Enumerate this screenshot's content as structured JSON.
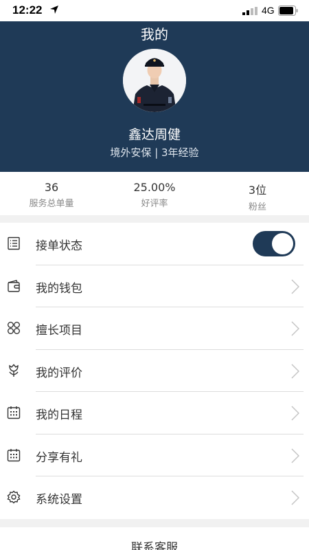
{
  "status_bar": {
    "time": "12:22",
    "network": "4G",
    "icons": [
      "location-arrow-icon",
      "signal-icon",
      "battery-icon"
    ]
  },
  "header": {
    "title": "我的",
    "name": "鑫达周健",
    "description": "境外安保 | 3年经验"
  },
  "stats": [
    {
      "value": "36",
      "label": "服务总单量"
    },
    {
      "value": "25.00%",
      "label": "好评率"
    },
    {
      "value": "3位",
      "label": "粉丝"
    }
  ],
  "menu": [
    {
      "label": "接单状态",
      "icon": "list-icon",
      "control": "toggle",
      "toggle_on": true
    },
    {
      "label": "我的钱包",
      "icon": "wallet-icon",
      "control": "chevron"
    },
    {
      "label": "擅长项目",
      "icon": "grid-icon",
      "control": "chevron"
    },
    {
      "label": "我的评价",
      "icon": "flower-icon",
      "control": "chevron"
    },
    {
      "label": "我的日程",
      "icon": "calendar-icon",
      "control": "chevron"
    },
    {
      "label": "分享有礼",
      "icon": "calendar-icon",
      "control": "chevron"
    },
    {
      "label": "系统设置",
      "icon": "gear-icon",
      "control": "chevron"
    }
  ],
  "footer": {
    "contact_label": "联系客服"
  },
  "colors": {
    "header_bg": "#1f3a57",
    "toggle_on": "#1f3a57",
    "page_bg": "#f1f1f1"
  }
}
